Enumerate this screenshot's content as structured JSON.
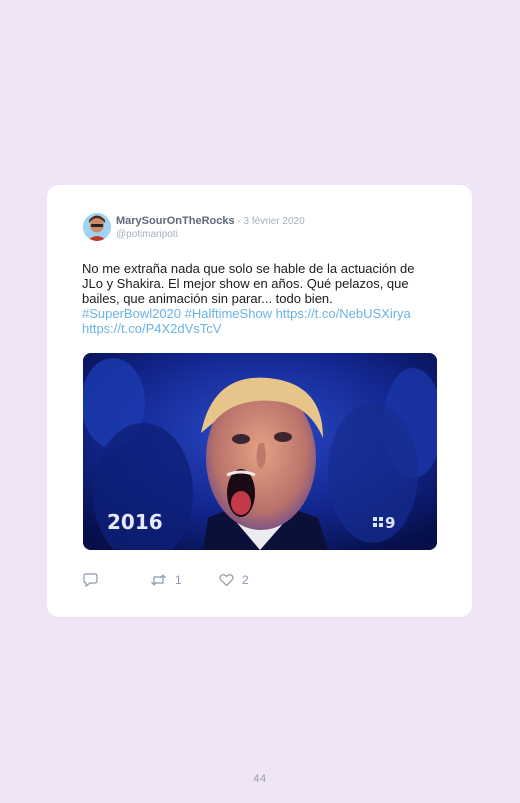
{
  "tweet": {
    "user_name": "MarySourOnTheRocks",
    "separator": " - ",
    "date": "3 février 2020",
    "handle": "@potimaripoti",
    "text_lines": [
      "No me extraña nada que solo se hable de la actuación de",
      "JLo y Shakira. El mejor show en años. Qué pelazos, que",
      "bailes, que animación sin parar... todo bien."
    ],
    "links_line_1": "#SuperBowl2020 #HalftimeShow https://t.co/NebUSXirya",
    "links_line_2": "https://t.co/P4X2dVsTcV",
    "media": {
      "overlay_left": "2016",
      "overlay_right": "9"
    },
    "actions": {
      "reply_icon": "reply-icon",
      "retweet_icon": "retweet-icon",
      "retweet_count": "1",
      "like_icon": "heart-icon",
      "like_count": "2"
    }
  },
  "page": {
    "number": "44"
  },
  "colors": {
    "background": "#efe5f7",
    "card": "#ffffff",
    "link": "#6ab3e8",
    "muted": "#a6b1bd"
  }
}
